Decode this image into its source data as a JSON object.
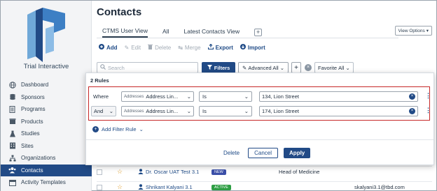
{
  "sidebar": {
    "brand": "Trial Interactive",
    "items": [
      {
        "label": "Dashboard",
        "icon": "globe-icon"
      },
      {
        "label": "Sponsors",
        "icon": "coins-icon"
      },
      {
        "label": "Programs",
        "icon": "document-icon"
      },
      {
        "label": "Products",
        "icon": "box-icon"
      },
      {
        "label": "Studies",
        "icon": "flask-icon"
      },
      {
        "label": "Sites",
        "icon": "building-icon"
      },
      {
        "label": "Organizations",
        "icon": "sitemap-icon"
      },
      {
        "label": "Contacts",
        "icon": "users-icon",
        "active": true
      },
      {
        "label": "Activity Templates",
        "icon": "calendar-icon"
      }
    ]
  },
  "header": {
    "title": "Contacts",
    "tabs": [
      "CTMS User View",
      "All",
      "Latest Contacts View"
    ],
    "tab_add": "+",
    "view_options": "View Options"
  },
  "toolbar": {
    "add": "Add",
    "edit": "Edit",
    "delete": "Delete",
    "merge": "Merge",
    "export": "Export",
    "import": "Import"
  },
  "search": {
    "placeholder": "Search",
    "filters_label": "Filters",
    "advanced_label": "Advanced All",
    "favorite_label": "Favorite",
    "favorite_value": "All"
  },
  "filter_panel": {
    "rules_count": "2 Rules",
    "rules": [
      {
        "prefix": "Where",
        "field_category": "Addresses",
        "field": "Address Lin...",
        "operator": "Is",
        "value": "134, Lion Street"
      },
      {
        "prefix": "And",
        "field_category": "Addresses",
        "field": "Address Lin...",
        "operator": "Is",
        "value": "174, Lion Street"
      }
    ],
    "add_rule": "Add Filter Rule",
    "delete": "Delete",
    "cancel": "Cancel",
    "apply": "Apply"
  },
  "table_rows": [
    {
      "name": "Dr. Oscar UAT Test 3.1",
      "badge": "NEW",
      "badge_color": "#3b4fa8",
      "role": "Head of Medicine",
      "email": ""
    },
    {
      "name": "Shrikant Kalyani 3.1",
      "badge": "ACTIVE",
      "badge_color": "#2e9e44",
      "role": "",
      "email": "skalyani3.1@tbd.com"
    }
  ],
  "colors": {
    "primary": "#214a86",
    "highlight_border": "#c62828"
  }
}
